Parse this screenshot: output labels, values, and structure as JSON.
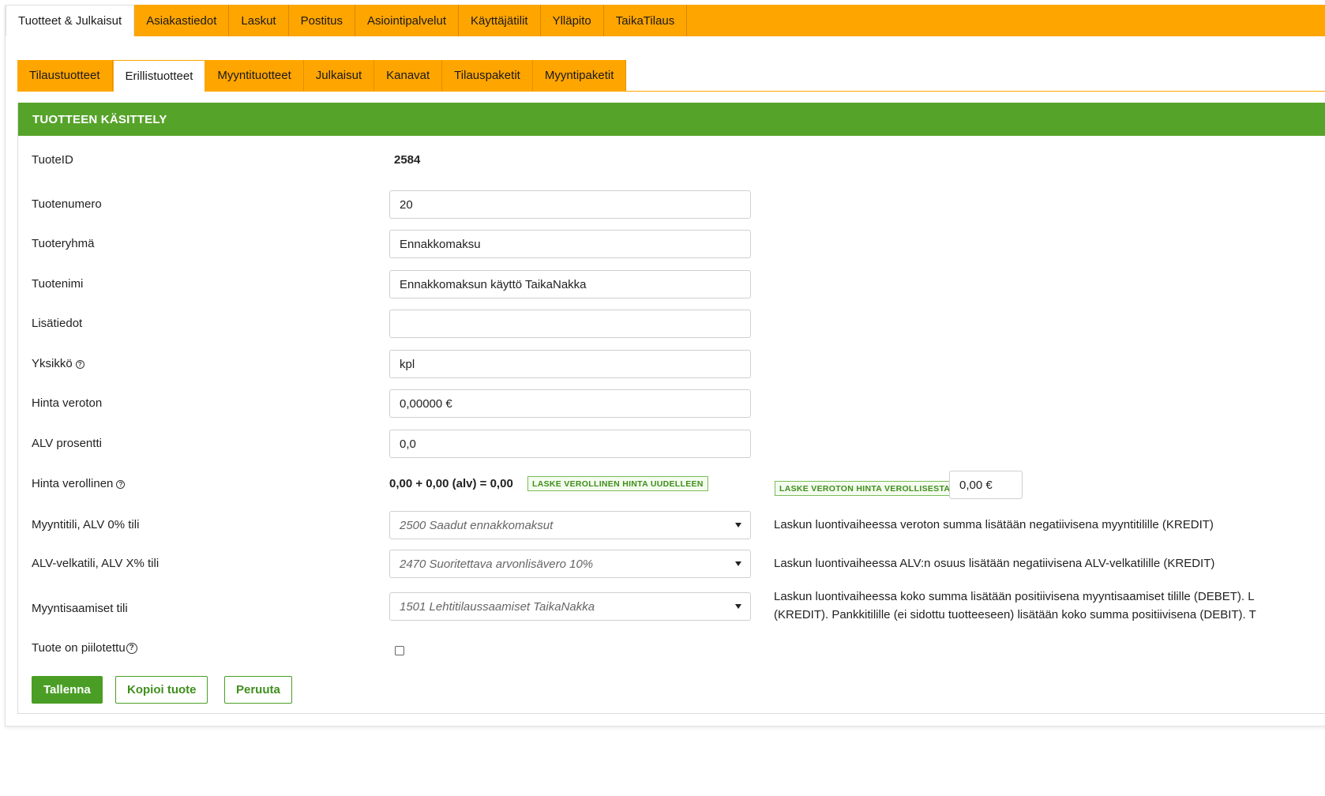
{
  "top_nav": [
    {
      "label": "Tuotteet & Julkaisut",
      "active": true
    },
    {
      "label": "Asiakastiedot"
    },
    {
      "label": "Laskut"
    },
    {
      "label": "Postitus"
    },
    {
      "label": "Asiointipalvelut"
    },
    {
      "label": "Käyttäjätilit"
    },
    {
      "label": "Ylläpito"
    },
    {
      "label": "TaikaTilaus"
    }
  ],
  "sub_nav": [
    {
      "label": "Tilaustuotteet"
    },
    {
      "label": "Erillistuotteet",
      "active": true
    },
    {
      "label": "Myyntituotteet"
    },
    {
      "label": "Julkaisut"
    },
    {
      "label": "Kanavat"
    },
    {
      "label": "Tilauspaketit"
    },
    {
      "label": "Myyntipaketit"
    }
  ],
  "panel": {
    "title": "TUOTTEEN KÄSITTELY"
  },
  "form": {
    "tuoteid": {
      "label": "TuoteID",
      "value": "2584"
    },
    "tuotenumero": {
      "label": "Tuotenumero",
      "value": "20"
    },
    "tuoteryhma": {
      "label": "Tuoteryhmä",
      "value": "Ennakkomaksu"
    },
    "tuotenimi": {
      "label": "Tuotenimi",
      "value": "Ennakkomaksun käyttö TaikaNakka"
    },
    "lisatiedot": {
      "label": "Lisätiedot",
      "value": ""
    },
    "yksikko": {
      "label": "Yksikkö",
      "value": "kpl"
    },
    "hinta_veroton": {
      "label": "Hinta veroton",
      "value": "0,00000 €"
    },
    "alv_prosentti": {
      "label": "ALV prosentti",
      "value": "0,0"
    },
    "hinta_verollinen": {
      "label": "Hinta verollinen",
      "formula": "0,00 + 0,00 (alv) = 0,00",
      "recalc_button": "LASKE VEROLLINEN HINTA UUDELLEEN",
      "reverse_button": "LASKE VEROTON HINTA VEROLLISESTA:",
      "reverse_value": "0,00 €"
    },
    "myyntitili": {
      "label": "Myyntitili, ALV 0% tili",
      "value": "2500 Saadut ennakkomaksut",
      "note": "Laskun luontivaiheessa veroton summa lisätään negatiivisena myyntitilille (KREDIT)"
    },
    "alv_velkatili": {
      "label": "ALV-velkatili, ALV X% tili",
      "value": "2470 Suoritettava arvonlisävero 10%",
      "note": "Laskun luontivaiheessa ALV:n osuus lisätään negatiivisena ALV-velkatilille (KREDIT)"
    },
    "myyntisaamiset": {
      "label": "Myyntisaamiset tili",
      "value": "1501 Lehtitilaussaamiset TaikaNakka",
      "note_line1": "Laskun luontivaiheessa koko summa lisätään positiivisena myyntisaamiset tilille (DEBET). L",
      "note_line2": "(KREDIT). Pankkitilille (ei sidottu tuotteeseen) lisätään koko summa positiivisena (DEBIT). T"
    },
    "piilotettu": {
      "label": "Tuote on piilotettu",
      "checked": false
    }
  },
  "actions": {
    "save": "Tallenna",
    "copy": "Kopioi tuote",
    "cancel": "Peruuta"
  },
  "colors": {
    "nav_orange": "#ffa500",
    "header_green": "#56a32a",
    "button_green": "#4a9e25"
  }
}
